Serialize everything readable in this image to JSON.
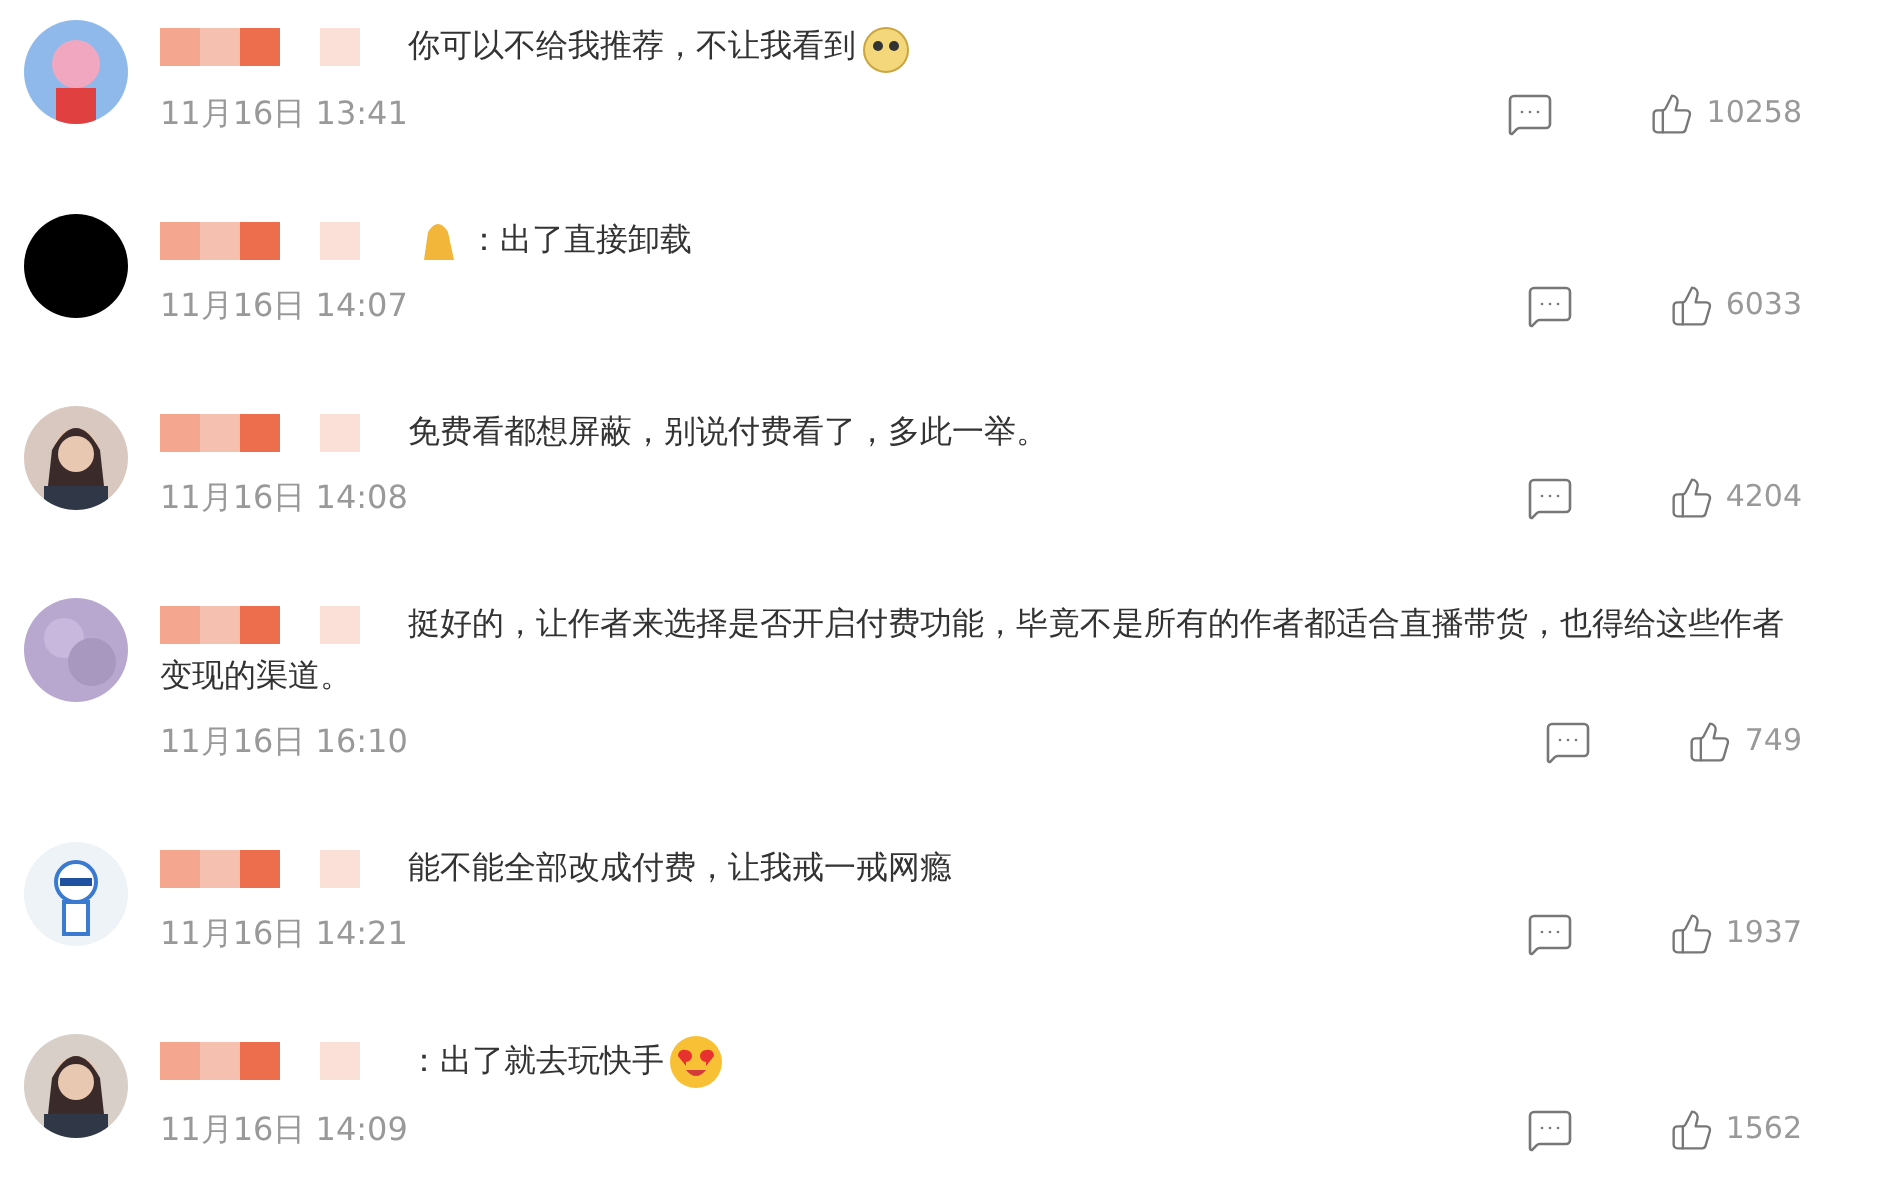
{
  "comments": [
    {
      "text": "你可以不给我推荐，不让我看到",
      "emoji_after": true,
      "time": "11月16日 13:41",
      "likes": "10258"
    },
    {
      "text": "：出了直接卸载",
      "emoji_before": true,
      "time": "11月16日 14:07",
      "likes": "6033"
    },
    {
      "text": "免费看都想屏蔽，别说付费看了，多此一举。",
      "time": "11月16日 14:08",
      "likes": "4204"
    },
    {
      "text": "挺好的，让作者来选择是否开启付费功能，毕竟不是所有的作者都适合直播带货，也得给这些作者变现的渠道。",
      "time": "11月16日 16:10",
      "likes": "749"
    },
    {
      "text": "能不能全部改成付费，让我戒一戒网瘾",
      "time": "11月16日 14:21",
      "likes": "1937"
    },
    {
      "text": "：出了就去玩快手",
      "emoji_after": true,
      "time": "11月16日 14:09",
      "likes": "1562"
    }
  ]
}
